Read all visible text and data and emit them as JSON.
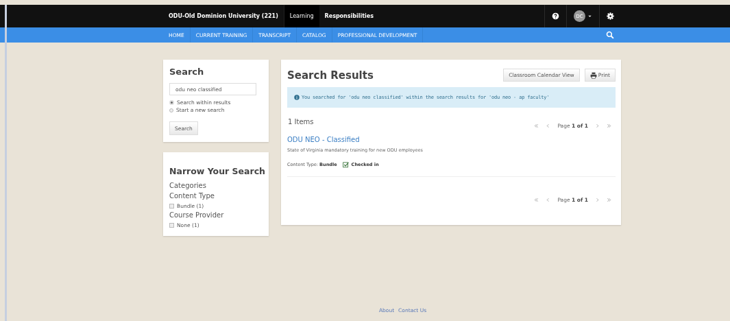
{
  "top_bar": {
    "portal": "ODU-Old Dominion University (221)",
    "tabs": [
      {
        "label": "Learning",
        "selected": true
      },
      {
        "label": "Responsibilities",
        "selected": false
      }
    ],
    "user_initials": "DC"
  },
  "nav": {
    "items": [
      {
        "label": "HOME"
      },
      {
        "label": "CURRENT TRAINING"
      },
      {
        "label": "TRANSCRIPT"
      },
      {
        "label": "CATALOG"
      },
      {
        "label": "PROFESSIONAL DEVELOPMENT"
      }
    ]
  },
  "search_panel": {
    "title": "Search",
    "query": "odu neo classified",
    "options": [
      {
        "label": "Search within results",
        "selected": true
      },
      {
        "label": "Start a new search",
        "selected": false
      }
    ],
    "button": "Search"
  },
  "narrow_panel": {
    "title": "Narrow Your Search",
    "categories_label": "Categories",
    "groups": [
      {
        "title": "Content Type",
        "filters": [
          {
            "label": "Bundle (1)",
            "checked": false
          }
        ]
      },
      {
        "title": "Course Provider",
        "filters": [
          {
            "label": "None (1)",
            "checked": false
          }
        ]
      }
    ]
  },
  "results": {
    "title": "Search Results",
    "buttons": [
      "Classroom Calendar View",
      "Print"
    ],
    "info": "You searched for 'odu neo classified' within the search results for 'odu neo - ap faculty'",
    "count": "1 Items",
    "pager_top": {
      "page_label": "Page",
      "page_value": "1 of 1"
    },
    "items": [
      {
        "title": "ODU NEO - Classified",
        "description": "State of Virginia mandatory training for new ODU employees",
        "type_label": "Content Type:",
        "type_value": "Bundle",
        "status": "Checked in",
        "checked_in": true
      }
    ],
    "pager_bottom": {
      "page_label": "Page",
      "page_value": "1 of 1"
    }
  },
  "footer": {
    "links": [
      "About",
      "Contact Us"
    ]
  }
}
